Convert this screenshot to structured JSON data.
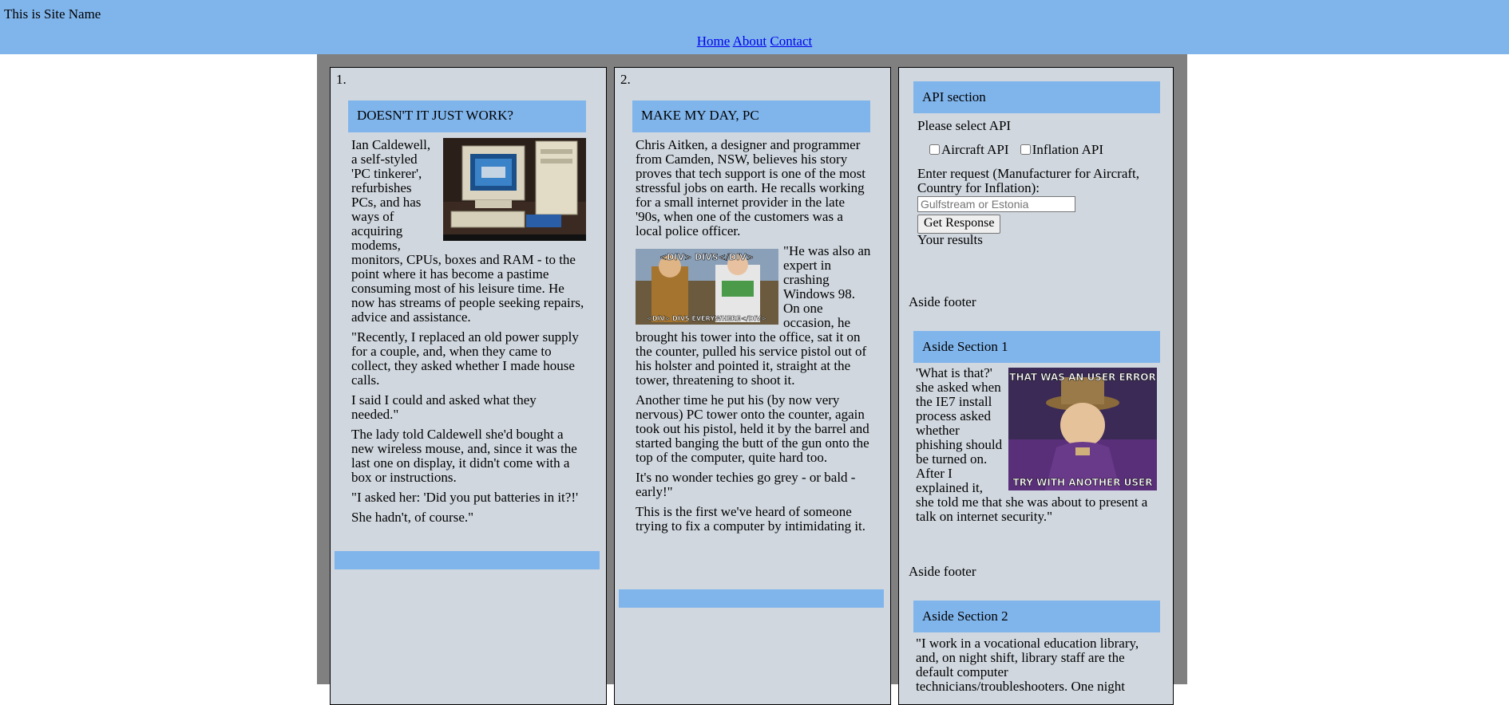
{
  "site": {
    "name": "This is Site Name"
  },
  "nav": {
    "home": "Home",
    "about": "About",
    "contact": "Contact"
  },
  "articles": [
    {
      "number": "1.",
      "title": "DOESN'T IT JUST WORK?",
      "image_caption": "Photo of a retro PC with Windows 95 screen",
      "paragraphs": [
        "Ian Caldewell, a self-styled 'PC tinkerer', refurbishes PCs, and has ways of acquiring modems, monitors, CPUs, boxes and RAM - to the point where it has become a pastime consuming most of his leisure time. He now has streams of people seeking repairs, advice and assistance.",
        "\"Recently, I replaced an old power supply for a couple, and, when they came to collect, they asked whether I made house calls.",
        "I said I could and asked what they needed.\"",
        "The lady told Caldewell she'd bought a new wireless mouse, and, since it was the last one on display, it didn't come with a box or instructions.",
        "\"I asked her: 'Did you put batteries in it?!'",
        "She hadn't, of course.\""
      ]
    },
    {
      "number": "2.",
      "title": "MAKE MY DAY, PC",
      "image_top_text": "<DIV> DIVS</DIV>",
      "image_bottom_text": "<DIV> DIVS EVERYWHERE</DIV>",
      "paragraphs": [
        "Chris Aitken, a designer and programmer from Camden, NSW, believes his story proves that tech support is one of the most stressful jobs on earth. He recalls working for a small internet provider in the late '90s, when one of the customers was a local police officer.",
        "\"He was also an expert in crashing Windows 98. On one occasion, he brought his tower into the office, sat it on the counter, pulled his service pistol out of his holster and pointed it, straight at the tower, threatening to shoot it.",
        "Another time he put his (by now very nervous) PC tower onto the counter, again took out his pistol, held it by the barrel and started banging the butt of the gun onto the top of the computer, quite hard too.",
        "It's no wonder techies go grey - or bald - early!\"",
        "This is the first we've heard of someone trying to fix a computer by intimidating it."
      ]
    }
  ],
  "aside": {
    "api": {
      "title": "API section",
      "select_label": "Please select API",
      "option1": "Aircraft API",
      "option2": "Inflation API",
      "request_label": "Enter request (Manufacturer for Aircraft, Country for Inflation):",
      "placeholder": "Gulfstream or Estonia",
      "button": "Get Response",
      "results": "Your results"
    },
    "footer1": "Aside footer",
    "section1": {
      "title": "Aside Section 1",
      "image_top_text": "THAT WAS AN USER ERROR",
      "image_bottom_text": "TRY WITH ANOTHER USER",
      "text": "'What is that?' she asked when the IE7 install process asked whether phishing should be turned on. After I explained it, she told me that she was about to present a talk on internet security.\""
    },
    "footer2": "Aside footer",
    "section2": {
      "title": "Aside Section 2",
      "text": "\"I work in a vocational education library, and, on night shift, library staff are the default computer technicians/troubleshooters. One night"
    }
  }
}
